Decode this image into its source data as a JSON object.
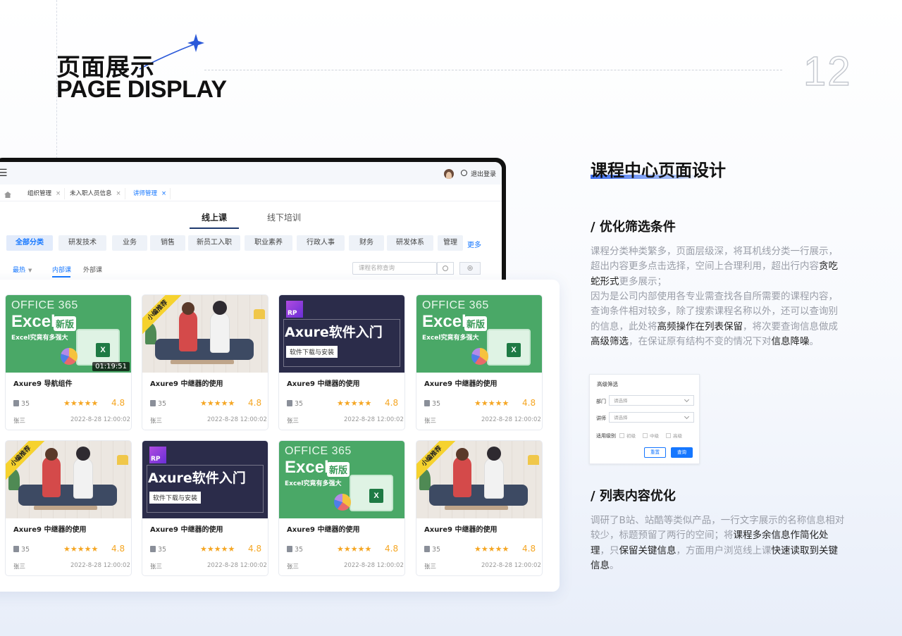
{
  "header": {
    "title_cn": "页面展示",
    "title_en": "PAGE DISPLAY",
    "page_number": "12"
  },
  "app": {
    "logout_label": "退出登录",
    "breadcrumb_tabs": [
      {
        "label": "组织管理",
        "close": "×"
      },
      {
        "label": "未入职人员信息",
        "close": "×"
      },
      {
        "label": "讲师管理",
        "close": "×"
      }
    ],
    "main_tabs": [
      "线上课",
      "线下培训"
    ],
    "categories": [
      "全部分类",
      "研发技术",
      "业务",
      "销售",
      "新员工入职",
      "职业素养",
      "行政人事",
      "财务",
      "研发体系",
      "管理"
    ],
    "more_label": "更多",
    "sub_tabs": [
      "最热",
      "内部课",
      "外部课"
    ],
    "search_placeholder": "课程名称查询"
  },
  "cards": [
    {
      "thumb": "office",
      "ribbon": "",
      "duration": "01:19:51",
      "title": "Axure9 导航组件",
      "count": "35",
      "rating": "4.8",
      "author": "张三",
      "date": "2022-8-28 12:00:02"
    },
    {
      "thumb": "people",
      "ribbon": "小编推荐",
      "duration": "",
      "title": "Axure9 中继器的使用",
      "count": "35",
      "rating": "4.8",
      "author": "张三",
      "date": "2022-8-28 12:00:02"
    },
    {
      "thumb": "axure",
      "ribbon": "",
      "duration": "",
      "title": "Axure9 中继器的使用",
      "count": "35",
      "rating": "4.8",
      "author": "张三",
      "date": "2022-8-28 12:00:02"
    },
    {
      "thumb": "office",
      "ribbon": "",
      "duration": "",
      "title": "Axure9 中继器的使用",
      "count": "35",
      "rating": "4.8",
      "author": "张三",
      "date": "2022-8-28 12:00:02"
    },
    {
      "thumb": "people",
      "ribbon": "小编推荐",
      "duration": "",
      "title": "Axure9 中继器的使用",
      "count": "35",
      "rating": "4.8",
      "author": "张三",
      "date": "2022-8-28 12:00:02"
    },
    {
      "thumb": "axure",
      "ribbon": "",
      "duration": "",
      "title": "Axure9 中继器的使用",
      "count": "35",
      "rating": "4.8",
      "author": "张三",
      "date": "2022-8-28 12:00:02"
    },
    {
      "thumb": "office",
      "ribbon": "",
      "duration": "",
      "title": "Axure9 中继器的使用",
      "count": "35",
      "rating": "4.8",
      "author": "张三",
      "date": "2022-8-28 12:00:02"
    },
    {
      "thumb": "people",
      "ribbon": "小编推荐",
      "duration": "",
      "title": "Axure9 中继器的使用",
      "count": "35",
      "rating": "4.8",
      "author": "张三",
      "date": "2022-8-28 12:00:02"
    }
  ],
  "thumbs": {
    "office_line1": "OFFICE 365",
    "office_line2": "Excel",
    "office_badge": "新版",
    "office_sub": "Excel究竟有多强大",
    "office_x": "X",
    "axure_rp": "RP",
    "axure_title": "Axure软件入门",
    "axure_sub": "软件下载与安装"
  },
  "right": {
    "heading": "课程中心页面设计",
    "sec1_title": "/ 优化筛选条件",
    "sec1_p1": [
      {
        "t": "课程分类种类繁多，页面层级深，将耳机线分类一行展示，超出内容更多点击选择，空间上合理利用，超出行内容",
        "b": false
      },
      {
        "t": "贪吃蛇形式",
        "b": true
      },
      {
        "t": "更多展示；",
        "b": false
      }
    ],
    "sec1_p2": [
      {
        "t": "因为是公司内部使用各专业需查找各自所需要的课程内容，查询条件相对较多，除了搜索课程名称以外，还可以查询别的信息，此处将",
        "b": false
      },
      {
        "t": "高频操作在列表保留",
        "b": true
      },
      {
        "t": "，将次要查询信息做成",
        "b": false
      },
      {
        "t": "高级筛选",
        "b": true
      },
      {
        "t": "，在保证原有结构不变的情况下对",
        "b": false
      },
      {
        "t": "信息降噪",
        "b": true
      },
      {
        "t": "。",
        "b": false
      }
    ],
    "sec2_title": "/ 列表内容优化",
    "sec2_p": [
      {
        "t": "调研了B站、站酷等类似产品，一行文字展示的名称信息相对较少，标题预留了两行的空间；将",
        "b": false
      },
      {
        "t": "课程多余信息作简化处理",
        "b": true
      },
      {
        "t": "，只",
        "b": false
      },
      {
        "t": "保留关键信息",
        "b": true
      },
      {
        "t": "，方面用户浏览线上课",
        "b": false
      },
      {
        "t": "快速读取到关键信息",
        "b": true
      },
      {
        "t": "。",
        "b": false
      }
    ]
  },
  "advanced_filter": {
    "title": "高级筛选",
    "dept_label": "部门",
    "dept_placeholder": "请选择",
    "teacher_label": "讲师",
    "teacher_placeholder": "请选择",
    "level_label": "适用级别",
    "levels": [
      "初级",
      "中级",
      "高级"
    ],
    "reset_label": "重置",
    "query_label": "查询"
  },
  "colors": {
    "accent": "#1677ff",
    "star": "#f5a623",
    "office_green": "#4aa867",
    "axure_navy": "#2b2c4a"
  }
}
